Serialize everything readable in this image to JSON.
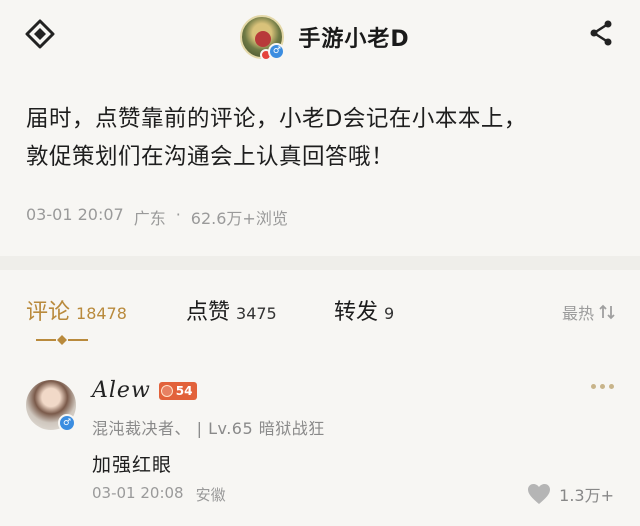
{
  "header": {
    "title": "手游小老D",
    "back_icon": "diamond-back-icon",
    "share_icon": "share-icon"
  },
  "post": {
    "text_line1": "届时，点赞靠前的评论，小老D会记在小本本上，",
    "text_line2": "敦促策划们在沟通会上认真回答哦！",
    "time": "03-01 20:07",
    "location": "广东",
    "views": "62.6万+浏览"
  },
  "tabs": {
    "comment_label": "评论",
    "comment_count": "18478",
    "like_label": "点赞",
    "like_count": "3475",
    "repost_label": "转发",
    "repost_count": "9",
    "sort_label": "最热"
  },
  "comment": {
    "name": "Alew",
    "level": "54",
    "tag": "混沌裁决者、 | Lv.65 暗狱战狂",
    "text": "加强红眼",
    "time": "03-01 20:08",
    "location": "安徽",
    "like_count": "1.3万+"
  },
  "colors": {
    "accent": "#b98a3c",
    "background": "#f7f6f3",
    "level_badge": "#e2623b",
    "verified": "#3b8de0"
  }
}
